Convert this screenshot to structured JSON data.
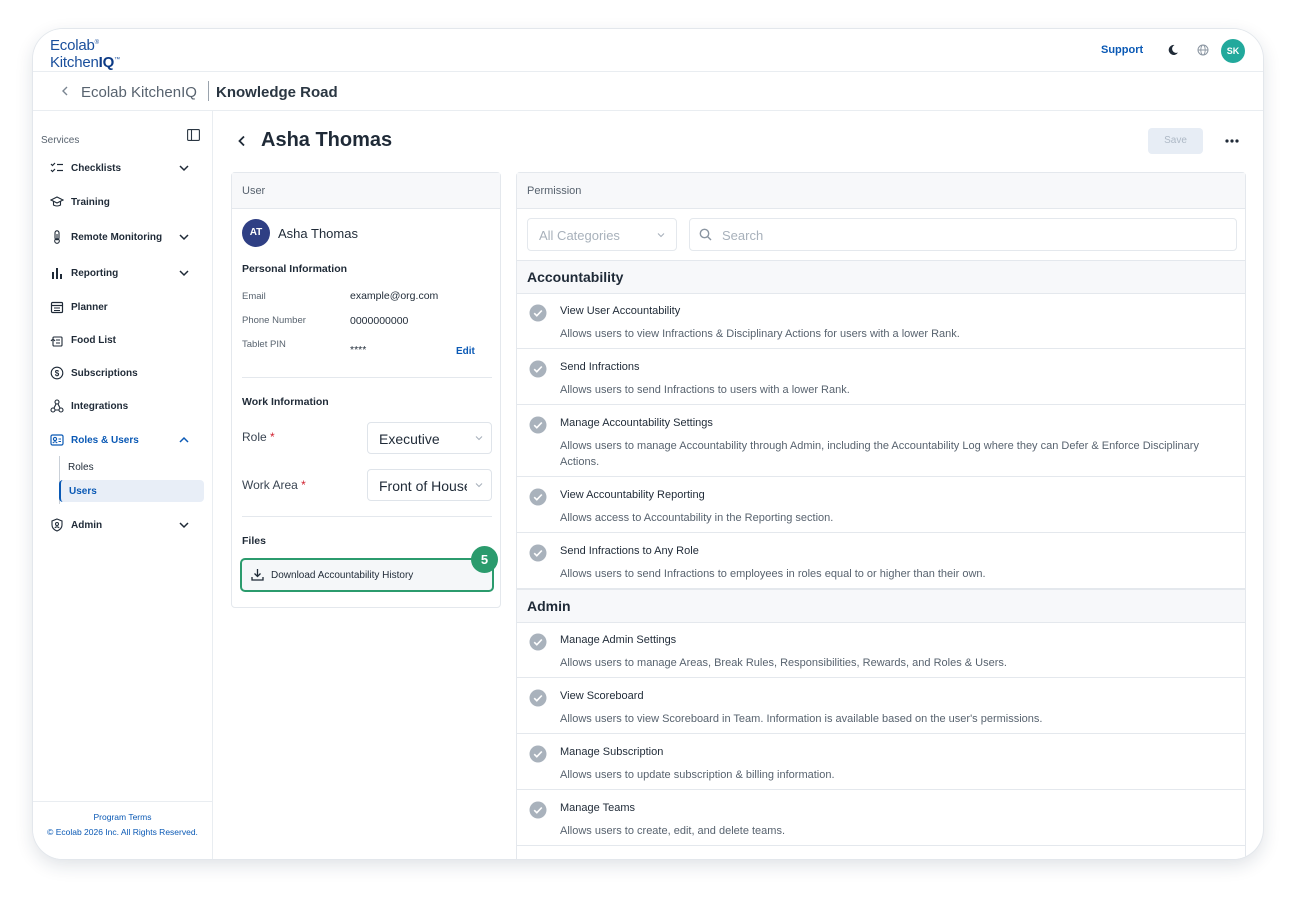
{
  "brand": {
    "line1": "Ecolab",
    "line2_plain": "Kitchen",
    "line2_bold": "IQ",
    "tm": "™",
    "reg": "®"
  },
  "topbar": {
    "support": "Support",
    "avatar_initials": "SK",
    "moon_icon": "moon-icon",
    "globe_icon": "globe-icon"
  },
  "breadcrumb": {
    "app": "Ecolab KitchenIQ",
    "page": "Knowledge Road"
  },
  "sidebar": {
    "section_label": "Services",
    "items": [
      {
        "label": "Checklists",
        "icon": "checklist-icon",
        "expandable": true
      },
      {
        "label": "Training",
        "icon": "graduation-cap-icon",
        "expandable": false
      },
      {
        "label": "Remote Monitoring",
        "icon": "thermometer-icon",
        "expandable": true
      },
      {
        "label": "Reporting",
        "icon": "bar-chart-icon",
        "expandable": true
      },
      {
        "label": "Planner",
        "icon": "calendar-icon",
        "expandable": false
      },
      {
        "label": "Food List",
        "icon": "food-list-icon",
        "expandable": false
      },
      {
        "label": "Subscriptions",
        "icon": "dollar-icon",
        "expandable": false
      },
      {
        "label": "Integrations",
        "icon": "integrations-icon",
        "expandable": false
      },
      {
        "label": "Roles & Users",
        "icon": "roles-users-icon",
        "expandable": true,
        "active": true
      },
      {
        "label": "Admin",
        "icon": "shield-icon",
        "expandable": true
      }
    ],
    "sub_items": [
      {
        "label": "Roles"
      },
      {
        "label": "Users",
        "active": true
      }
    ],
    "footer": {
      "terms": "Program Terms",
      "copyright": "© Ecolab 2026 Inc. All Rights Reserved."
    }
  },
  "page": {
    "title": "Asha Thomas",
    "save_label": "Save"
  },
  "user_card": {
    "header": "User",
    "avatar_initials": "AT",
    "name": "Asha Thomas",
    "personal_title": "Personal Information",
    "email_label": "Email",
    "email_value": "example@org.com",
    "phone_label": "Phone Number",
    "phone_value": "0000000000",
    "pin_label": "Tablet PIN",
    "pin_value": "****",
    "edit_label": "Edit",
    "work_title": "Work Information",
    "role_label": "Role",
    "role_value": "Executive",
    "area_label": "Work Area",
    "area_value": "Front of House",
    "required_mark": "*",
    "files_title": "Files",
    "download_label": "Download Accountability History",
    "step_badge": "5"
  },
  "permission_card": {
    "header": "Permission",
    "category_placeholder": "All Categories",
    "search_placeholder": "Search",
    "groups": [
      {
        "title": "Accountability",
        "items": [
          {
            "name": "View User Accountability",
            "desc": "Allows users to view Infractions & Disciplinary Actions for users with a lower Rank."
          },
          {
            "name": "Send Infractions",
            "desc": "Allows users to send Infractions to users with a lower Rank."
          },
          {
            "name": "Manage Accountability Settings",
            "desc": "Allows users to manage Accountability through Admin, including the Accountability Log where they can Defer & Enforce Disciplinary Actions."
          },
          {
            "name": "View Accountability Reporting",
            "desc": "Allows access to Accountability in the Reporting section."
          },
          {
            "name": "Send Infractions to Any Role",
            "desc": "Allows users to send Infractions to employees in roles equal to or higher than their own."
          }
        ]
      },
      {
        "title": "Admin",
        "items": [
          {
            "name": "Manage Admin Settings",
            "desc": "Allows users to manage Areas, Break Rules, Responsibilities, Rewards, and Roles & Users."
          },
          {
            "name": "View Scoreboard",
            "desc": "Allows users to view Scoreboard in Team. Information is available based on the user's permissions."
          },
          {
            "name": "Manage Subscription",
            "desc": "Allows users to update subscription & billing information."
          },
          {
            "name": "Manage Teams",
            "desc": "Allows users to create, edit, and delete teams."
          }
        ]
      }
    ]
  },
  "colors": {
    "accent": "#0a59b5",
    "highlight_green": "#2b9b6d",
    "avatar_teal": "#22a99c",
    "avatar_navy": "#2f3f84"
  }
}
